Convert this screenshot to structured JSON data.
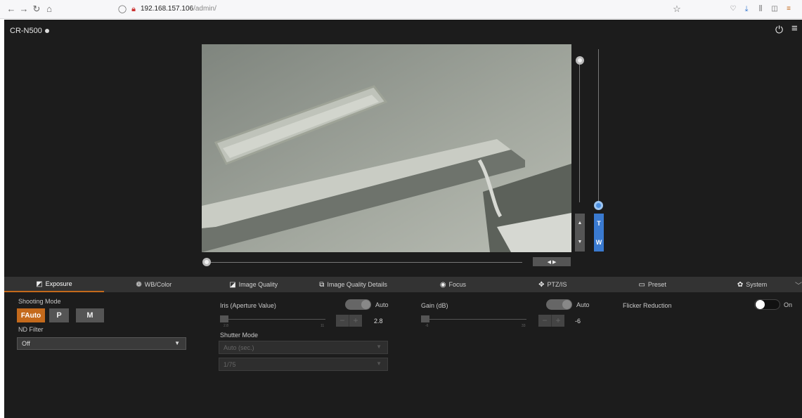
{
  "browser": {
    "url_host": "192.168.157.106",
    "url_path": "/admin/"
  },
  "header": {
    "model": "CR-N500"
  },
  "preview": {
    "pan_label": "◀ ▶",
    "tilt_up": "▲",
    "tilt_down": "▼",
    "zoom_tele": "T",
    "zoom_wide": "W"
  },
  "tabs": [
    {
      "label": "Exposure",
      "icon": "exposure-icon"
    },
    {
      "label": "WB/Color",
      "icon": "wb-color-icon"
    },
    {
      "label": "Image Quality",
      "icon": "image-quality-icon"
    },
    {
      "label": "Image Quality Details",
      "icon": "image-quality-details-icon"
    },
    {
      "label": "Focus",
      "icon": "focus-icon"
    },
    {
      "label": "PTZ/IS",
      "icon": "ptz-icon"
    },
    {
      "label": "Preset",
      "icon": "preset-icon"
    },
    {
      "label": "System",
      "icon": "gear-icon"
    }
  ],
  "exposure": {
    "shooting_mode_label": "Shooting Mode",
    "modes": [
      "FAuto",
      "P",
      "M"
    ],
    "selected_mode": "FAuto",
    "nd_filter_label": "ND Filter",
    "nd_filter_value": "Off",
    "iris_label": "Iris (Aperture Value)",
    "iris_auto_label": "Auto",
    "iris_value": "2.8",
    "iris_min_tick": "2.8",
    "iris_max_tick": "11",
    "shutter_mode_label": "Shutter Mode",
    "shutter_mode_value": "Auto (sec.)",
    "shutter_speed_value": "1/75",
    "gain_label": "Gain (dB)",
    "gain_auto_label": "Auto",
    "gain_value": "-6",
    "gain_min_tick": "-6",
    "gain_max_tick": "33",
    "flicker_label": "Flicker Reduction",
    "flicker_state": "On"
  },
  "colors": {
    "accent": "#c46a1c",
    "zoom_blue": "#3a7ad0",
    "background": "#1c1c1c"
  }
}
